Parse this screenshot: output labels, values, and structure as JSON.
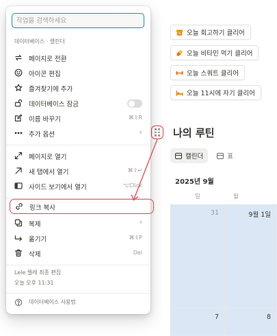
{
  "menu": {
    "search_placeholder": "작업을 검색하세요",
    "section_label": "데이터베이스 · 캘린더",
    "items": {
      "turn_into_page": "페이지로 전환",
      "edit_icon": "아이콘 편집",
      "add_favorite": "즐겨찾기에 추가",
      "lock_database": "데이터베이스 잠금",
      "rename": "이름 바꾸기",
      "rename_shortcut": "⌘⇧R",
      "more_options": "추가 옵션",
      "open_as_page": "페이지로 열기",
      "open_new_tab": "새 탭에서 열기",
      "open_new_tab_shortcut": "⌘⇧↵",
      "open_side_peek": "사이드 보기에서 열기",
      "open_side_peek_shortcut": "⌥Click",
      "copy_link": "링크 복사",
      "duplicate": "복제",
      "move_to": "옮기기",
      "move_to_shortcut": "⌘⇧P",
      "delete": "삭제",
      "delete_shortcut": "Del"
    },
    "footer": {
      "last_edited_by": "Lele 렐레 최종 편집",
      "last_edited_time": "오늘 오후 11:31",
      "help": "데이터베이스 사용법"
    }
  },
  "todos": [
    {
      "label": "오늘 회고하기 클리어",
      "icon": "box-icon",
      "color": "#e8900c"
    },
    {
      "label": "오늘 비타민 먹기 클리어",
      "icon": "pill-icon",
      "color": "#e8700c"
    },
    {
      "label": "오늘 스쿼트 클리어",
      "icon": "dumbbell-icon",
      "color": "#e8700c"
    },
    {
      "label": "오늘 11시에 자기 클리어",
      "icon": "bed-icon",
      "color": "#e8900c"
    }
  ],
  "database": {
    "title": "나의 루틴",
    "views": {
      "calendar": "캘린더",
      "table": "표"
    },
    "month": "2025년 9월",
    "weekdays": [
      "일",
      "월"
    ],
    "days": {
      "r1c1": "31",
      "r1c2": "9월 1일",
      "r2c1": "7",
      "r2c2": "8"
    }
  },
  "colors": {
    "accent": "#2383e2",
    "annotation": "#e5484d",
    "calendar_highlight": "#dbe7f5"
  }
}
